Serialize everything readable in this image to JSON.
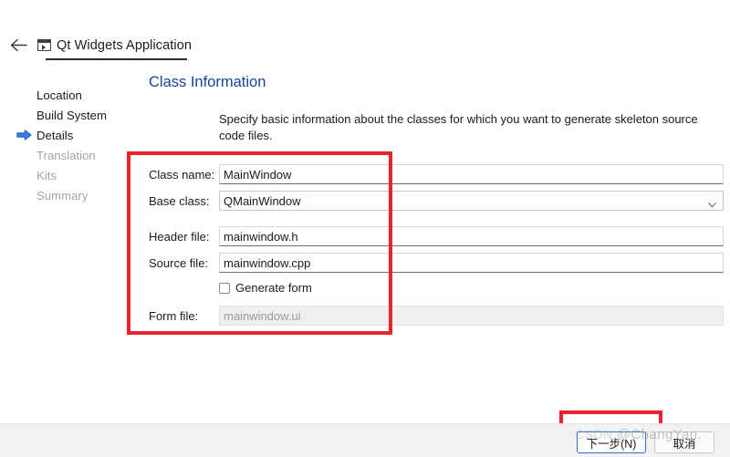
{
  "window": {
    "back_icon": "back-arrow-icon",
    "app_icon": "qt-app-icon",
    "title": "Qt Widgets Application"
  },
  "sidebar": {
    "steps": [
      {
        "label": "Location",
        "state": "done",
        "current": false
      },
      {
        "label": "Build System",
        "state": "done",
        "current": false
      },
      {
        "label": "Details",
        "state": "current",
        "current": true
      },
      {
        "label": "Translation",
        "state": "pending",
        "current": false
      },
      {
        "label": "Kits",
        "state": "pending",
        "current": false
      },
      {
        "label": "Summary",
        "state": "pending",
        "current": false
      }
    ],
    "current_marker_icon": "blue-arrow-cursor-icon"
  },
  "page": {
    "title": "Class Information",
    "title_color": "#19439c",
    "description": "Specify basic information about the classes for which you want to generate skeleton source code files."
  },
  "form": {
    "class_name": {
      "label": "Class name:",
      "value": "MainWindow",
      "type": "text"
    },
    "base_class": {
      "label": "Base class:",
      "value": "QMainWindow",
      "type": "combobox",
      "arrow_icon": "chevron-down-icon"
    },
    "header_file": {
      "label": "Header file:",
      "value": "mainwindow.h",
      "type": "text"
    },
    "source_file": {
      "label": "Source file:",
      "value": "mainwindow.cpp",
      "type": "text"
    },
    "generate_form": {
      "label": "Generate form",
      "checked": false,
      "type": "checkbox"
    },
    "form_file": {
      "label": "Form file:",
      "value": "mainwindow.ui",
      "type": "text",
      "disabled": true
    }
  },
  "footer": {
    "next_button": "下一步(N)",
    "cancel_button": "取消"
  },
  "annotations": {
    "highlight_color": "#e8232a",
    "form_box_label": "class-information-fields-highlight",
    "next_box_label": "next-button-highlight"
  },
  "watermark": {
    "csdn": "CSDN",
    "handle": "@ChangYan."
  }
}
